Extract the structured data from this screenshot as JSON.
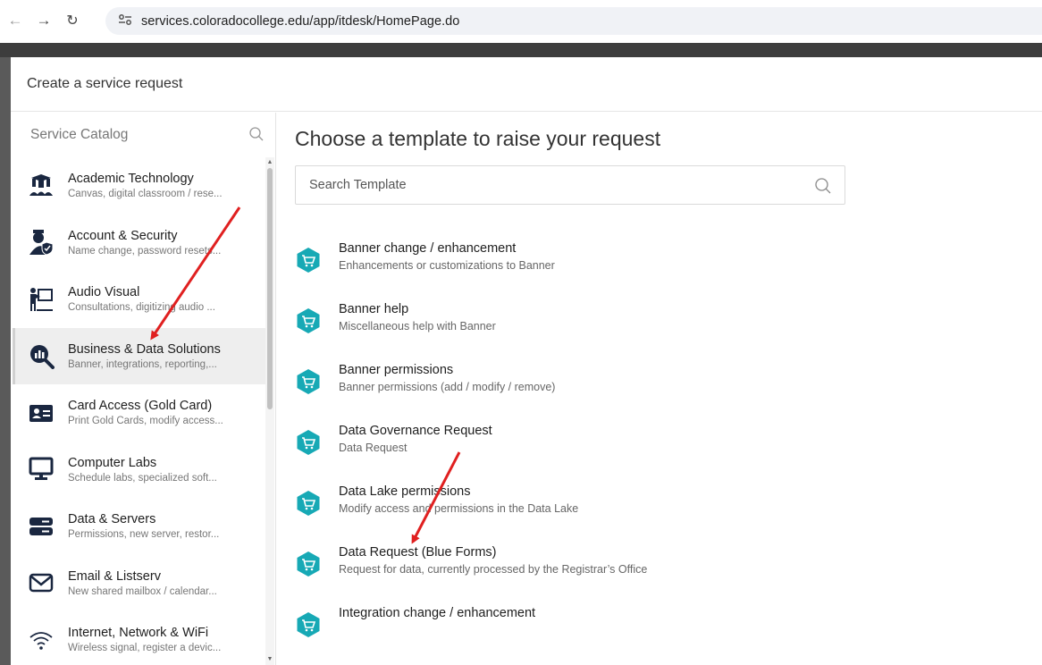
{
  "browser": {
    "url": "services.coloradocollege.edu/app/itdesk/HomePage.do"
  },
  "modal": {
    "title": "Create a service request"
  },
  "catalog": {
    "label": "Service Catalog",
    "items": [
      {
        "name": "Academic Technology",
        "desc": "Canvas, digital classroom / rese...",
        "icon": "graduation-class-icon",
        "selected": false
      },
      {
        "name": "Account & Security",
        "desc": "Name change, password resets...",
        "icon": "user-security-icon",
        "selected": false
      },
      {
        "name": "Audio Visual",
        "desc": "Consultations, digitizing audio ...",
        "icon": "presenter-board-icon",
        "selected": false
      },
      {
        "name": "Business & Data Solutions",
        "desc": "Banner, integrations, reporting,...",
        "icon": "data-magnifier-icon",
        "selected": true
      },
      {
        "name": "Card Access (Gold Card)",
        "desc": "Print Gold Cards, modify access...",
        "icon": "id-card-icon",
        "selected": false
      },
      {
        "name": "Computer Labs",
        "desc": "Schedule labs, specialized soft...",
        "icon": "monitor-icon",
        "selected": false
      },
      {
        "name": "Data & Servers",
        "desc": "Permissions, new server, restor...",
        "icon": "server-icon",
        "selected": false
      },
      {
        "name": "Email & Listserv",
        "desc": "New shared mailbox / calendar...",
        "icon": "envelope-icon",
        "selected": false
      },
      {
        "name": "Internet, Network & WiFi",
        "desc": "Wireless signal, register a devic...",
        "icon": "wifi-icon",
        "selected": false
      }
    ]
  },
  "main": {
    "title": "Choose a template to raise your request",
    "search_placeholder": "Search Template",
    "templates": [
      {
        "name": "Banner change / enhancement",
        "desc": "Enhancements or customizations to Banner"
      },
      {
        "name": "Banner help",
        "desc": "Miscellaneous help with Banner"
      },
      {
        "name": "Banner permissions",
        "desc": "Banner permissions (add / modify / remove)"
      },
      {
        "name": "Data Governance Request",
        "desc": "Data Request"
      },
      {
        "name": "Data Lake permissions",
        "desc": "Modify access and permissions in the Data Lake"
      },
      {
        "name": "Data Request (Blue Forms)",
        "desc": "Request for data, currently processed by the Registrar’s Office"
      },
      {
        "name": "Integration change / enhancement",
        "desc": ""
      }
    ]
  },
  "colors": {
    "template_icon": "#17a9b5",
    "annotation_arrow": "#e02020",
    "backdrop": "#5a5a5a"
  }
}
